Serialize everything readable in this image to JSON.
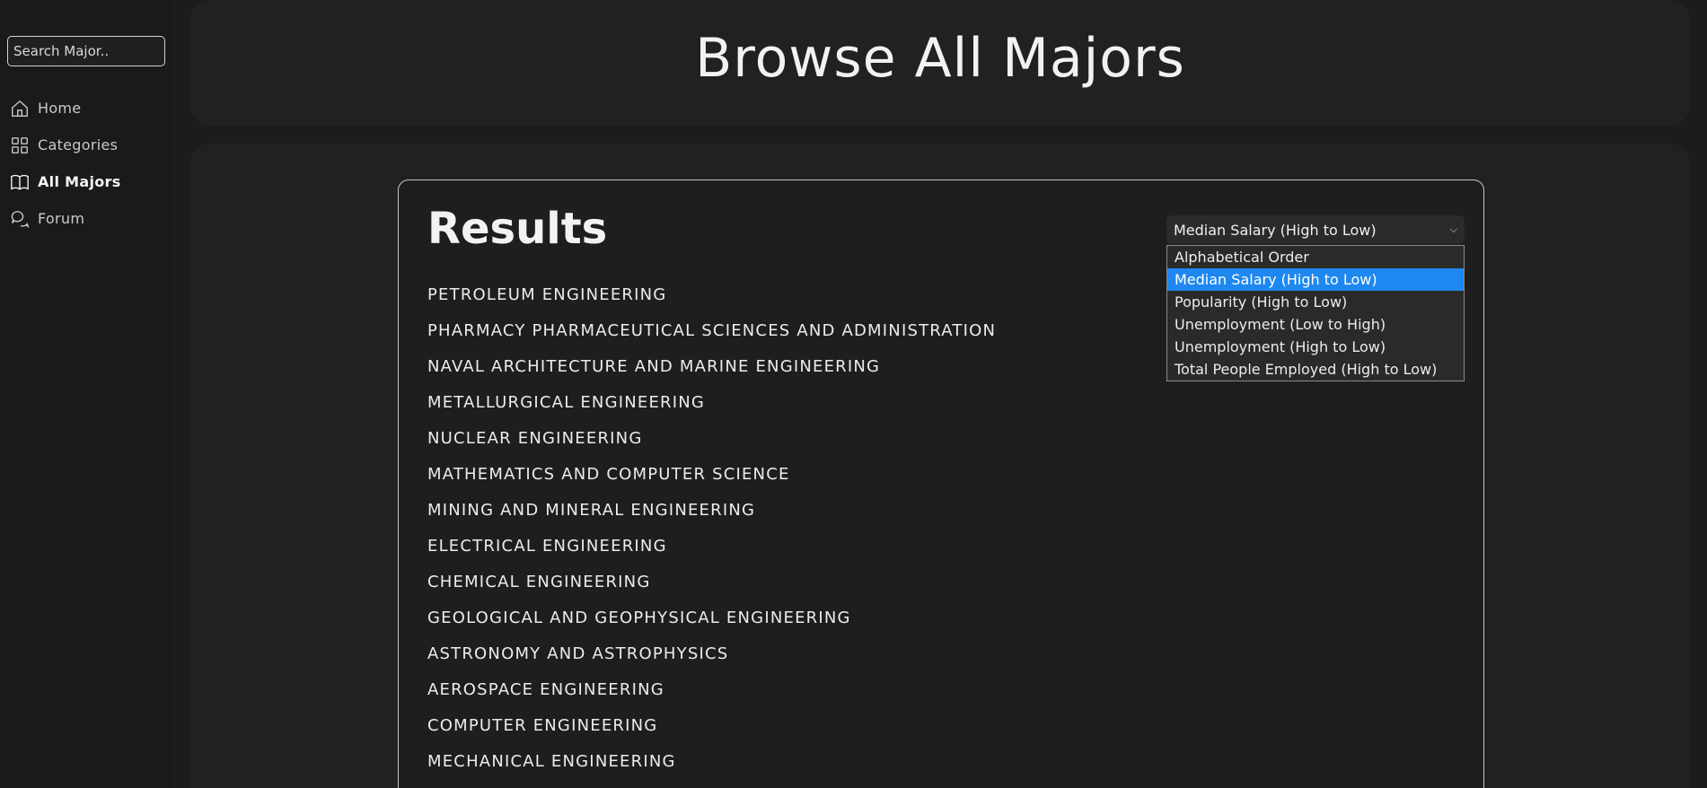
{
  "sidebar": {
    "search_placeholder": "Search Major..",
    "items": [
      {
        "label": "Home",
        "icon": "home-icon",
        "active": false
      },
      {
        "label": "Categories",
        "icon": "grid-icon",
        "active": false
      },
      {
        "label": "All Majors",
        "icon": "book-icon",
        "active": true
      },
      {
        "label": "Forum",
        "icon": "chat-icon",
        "active": false
      }
    ]
  },
  "header": {
    "title": "Browse All Majors"
  },
  "results": {
    "title": "Results",
    "majors": [
      "PETROLEUM ENGINEERING",
      "PHARMACY PHARMACEUTICAL SCIENCES AND ADMINISTRATION",
      "NAVAL ARCHITECTURE AND MARINE ENGINEERING",
      "METALLURGICAL ENGINEERING",
      "NUCLEAR ENGINEERING",
      "MATHEMATICS AND COMPUTER SCIENCE",
      "MINING AND MINERAL ENGINEERING",
      "ELECTRICAL ENGINEERING",
      "CHEMICAL ENGINEERING",
      "GEOLOGICAL AND GEOPHYSICAL ENGINEERING",
      "ASTRONOMY AND ASTROPHYSICS",
      "AEROSPACE ENGINEERING",
      "COMPUTER ENGINEERING",
      "MECHANICAL ENGINEERING"
    ]
  },
  "sort": {
    "selected": "Median Salary (High to Low)",
    "options": [
      "Alphabetical Order",
      "Median Salary (High to Low)",
      "Popularity (High to Low)",
      "Unemployment (Low to High)",
      "Unemployment (High to Low)",
      "Total People Employed (High to Low)"
    ],
    "highlight_color": "#1e88f0"
  }
}
